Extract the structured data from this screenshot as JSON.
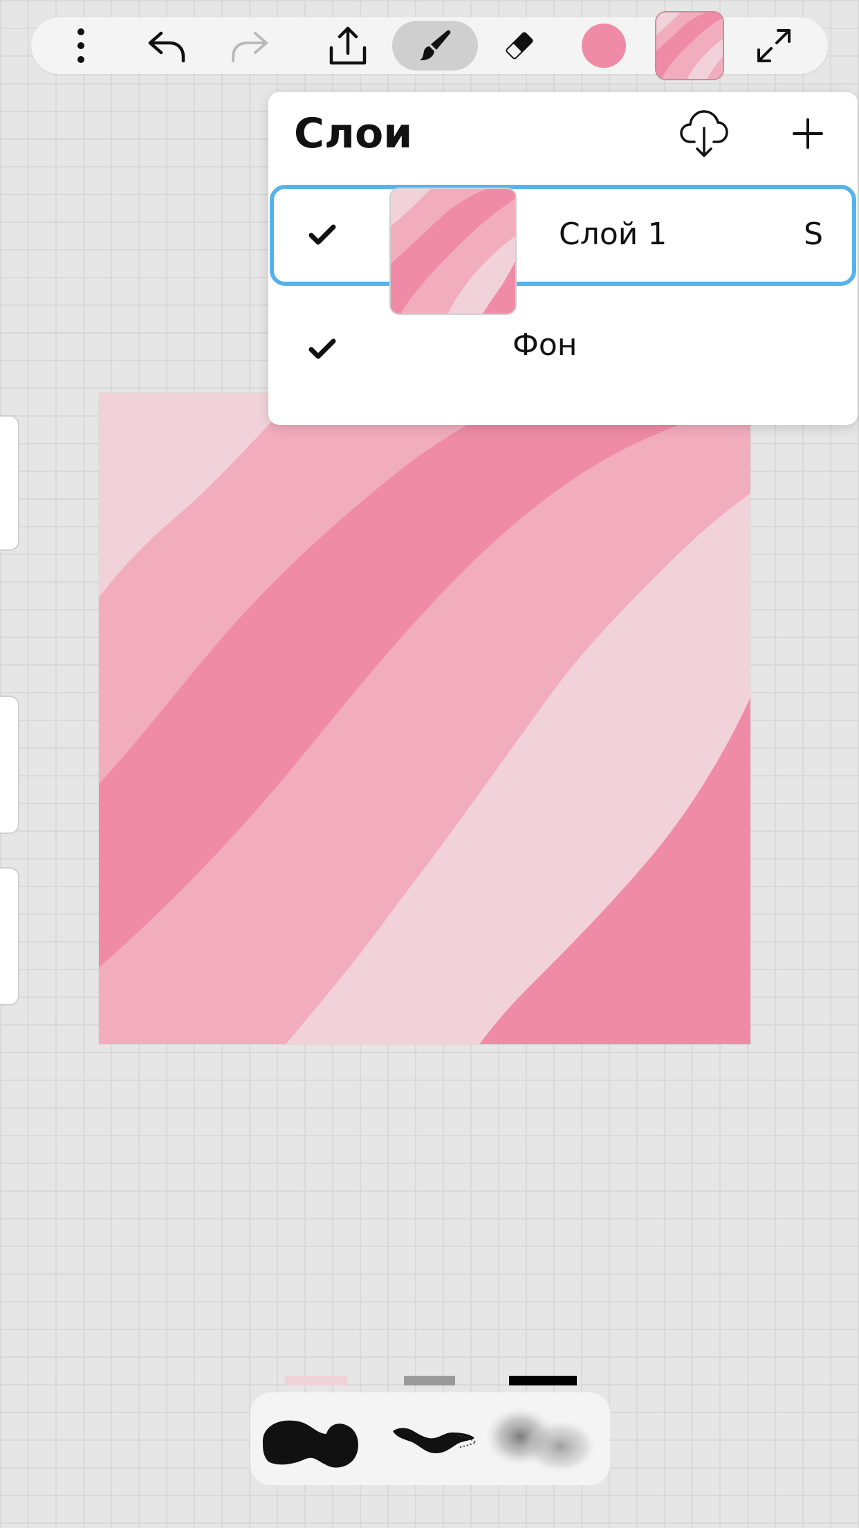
{
  "toolbar": {
    "items": [
      {
        "name": "more-menu",
        "icon": "more-vertical-icon"
      },
      {
        "name": "undo",
        "icon": "undo-icon"
      },
      {
        "name": "redo",
        "icon": "redo-icon",
        "state": "disabled"
      },
      {
        "name": "share",
        "icon": "share-icon"
      },
      {
        "name": "brush",
        "icon": "brush-icon",
        "state": "active"
      },
      {
        "name": "eraser",
        "icon": "eraser-icon"
      },
      {
        "name": "color",
        "icon": "color-swatch"
      },
      {
        "name": "layers",
        "icon": "layers-thumbnail"
      },
      {
        "name": "fullscreen",
        "icon": "expand-icon"
      }
    ],
    "current_color": "#ef8ba6"
  },
  "layers_panel": {
    "title": "Слои",
    "layers": [
      {
        "name": "Слой 1",
        "visible": true,
        "selected": true,
        "blend_mode": "S"
      },
      {
        "name": "Фон",
        "visible": true,
        "selected": false
      }
    ]
  },
  "colors": {
    "pink_light": "#f1d2da",
    "pink_mid": "#f1adbe",
    "pink_dark": "#ef8ba6",
    "selection": "#56b2ea",
    "brush_tab_1": "#f1d2da",
    "brush_tab_2": "#9a9a9a",
    "brush_tab_3": "#000000"
  },
  "brushes": [
    {
      "name": "round-brush",
      "icon": "round-brush-icon"
    },
    {
      "name": "ink-brush",
      "icon": "ink-brush-icon"
    },
    {
      "name": "soft-brush",
      "icon": "soft-brush-icon"
    }
  ]
}
